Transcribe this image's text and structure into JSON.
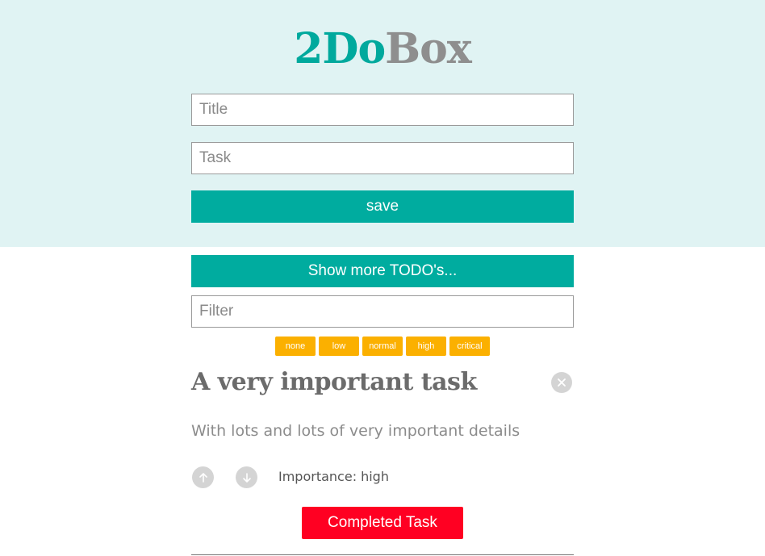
{
  "header": {
    "logo_part_a": "2Do",
    "logo_part_b": "Box",
    "title_placeholder": "Title",
    "task_placeholder": "Task",
    "save_label": "save"
  },
  "controls": {
    "show_more_label": "Show more TODO's...",
    "filter_placeholder": "Filter",
    "importance_filters": [
      "none",
      "low",
      "normal",
      "high",
      "critical"
    ]
  },
  "todo": {
    "title": "A very important task",
    "body": "With lots and lots of very important details",
    "importance_label": "Importance:",
    "importance_value": "high",
    "completed_label": "Completed Task"
  },
  "colors": {
    "header_bg": "#e0f3f3",
    "teal": "#00ac9f",
    "chip_orange": "#fbb000",
    "completed_red": "#ff0022",
    "icon_gray": "#d4d4d4"
  },
  "icons": {
    "delete": "close-circle-icon",
    "upvote": "arrow-up-circle-icon",
    "downvote": "arrow-down-circle-icon"
  }
}
